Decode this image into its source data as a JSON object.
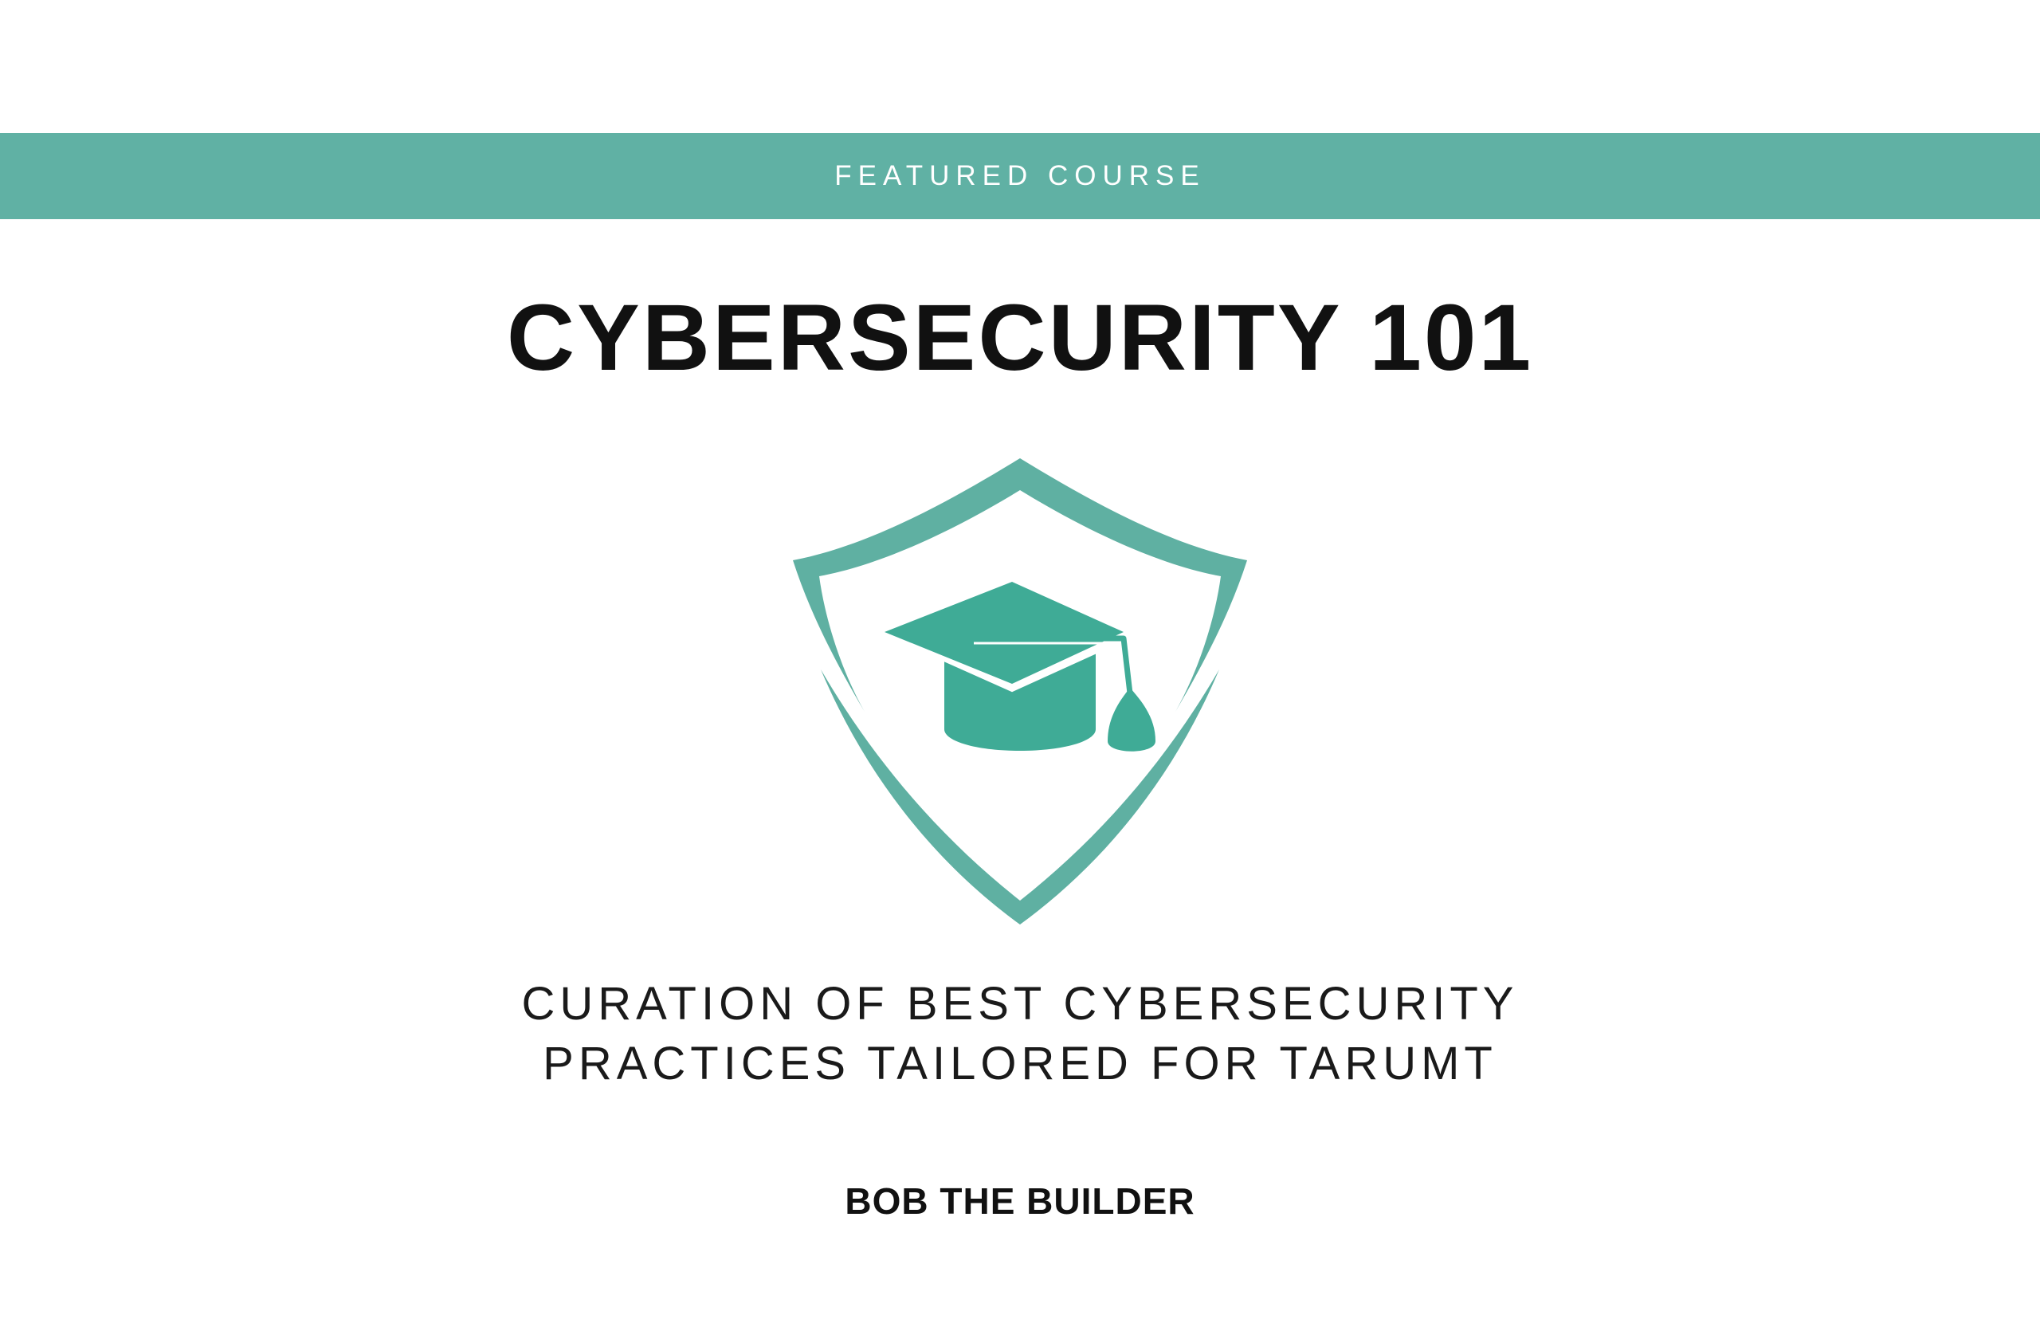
{
  "banner": {
    "label": "FEATURED COURSE",
    "color": "#60b1a4"
  },
  "course": {
    "title": "CYBERSECURITY 101",
    "emblem_icon": "shield-graduation-cap-icon",
    "emblem_color": "#5fb0a2",
    "cap_color": "#3fab96",
    "description_line1": "CURATION OF BEST CYBERSECURITY",
    "description_line2": "PRACTICES TAILORED FOR TARUMT",
    "author": "BOB THE BUILDER"
  }
}
